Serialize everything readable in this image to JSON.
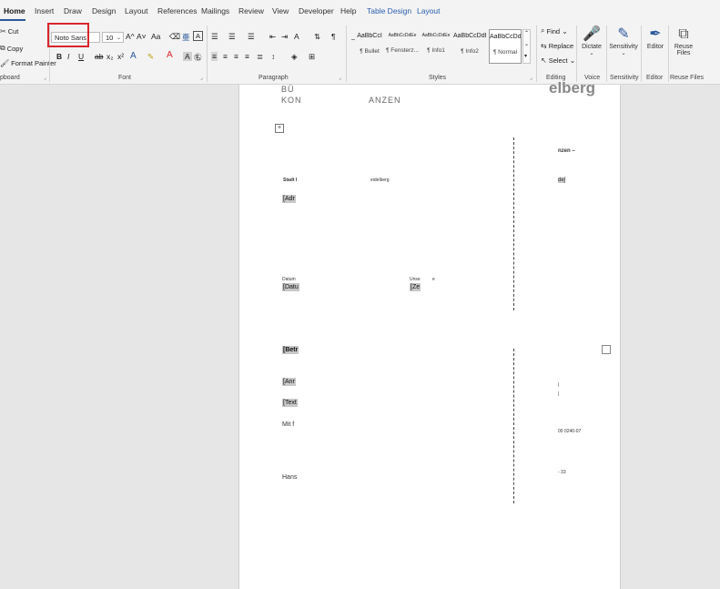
{
  "tabs": [
    "Home",
    "Insert",
    "Draw",
    "Design",
    "Layout",
    "References",
    "Mailings",
    "Review",
    "View",
    "Developer",
    "Help",
    "Table Design",
    "Layout"
  ],
  "clipboard": {
    "cut": "Cut",
    "copy": "Copy",
    "format_painter": "Format Painter",
    "label": "pboard"
  },
  "font": {
    "family": "Noto Sans",
    "size": "10",
    "label": "Font",
    "grow": "A^",
    "shrink": "A˅",
    "change_case": "Aa",
    "clear": "A",
    "bold": "B",
    "italic": "I",
    "underline": "U",
    "strike": "ab",
    "subscript": "x₂",
    "superscript": "x²",
    "effects": "A",
    "highlight": "✎",
    "font_color": "A"
  },
  "paragraph": {
    "label": "Paragraph"
  },
  "styles": {
    "label": "Styles",
    "items": [
      {
        "sample": "AaBbCcI",
        "name": "¶ Bullet"
      },
      {
        "sample": "AaBbCcDdEe",
        "name": "¶ Fensterz..."
      },
      {
        "sample": "AaBbCcDdEe",
        "name": "¶ Info1"
      },
      {
        "sample": "AaBbCcDdI",
        "name": "¶ Info2"
      },
      {
        "sample": "AaBbCcDdI",
        "name": "¶ Normal"
      }
    ]
  },
  "editing": {
    "label": "Editing",
    "find": "Find",
    "replace": "Replace",
    "select": "Select"
  },
  "voice": {
    "label": "Voice",
    "dictate": "Dictate"
  },
  "sensitivity": {
    "label": "Sensitivity",
    "button": "Sensitivity"
  },
  "editor": {
    "label": "Editor",
    "button": "Editor"
  },
  "reuse": {
    "label": "Reuse Files",
    "button_line1": "Reuse",
    "button_line2": "Files"
  },
  "document": {
    "header_left_1": "BÜ",
    "header_left_2": "KON",
    "header_mid": "ANZEN",
    "header_right": "elberg",
    "right_note": "nzen –",
    "sender_label": "Stadt I",
    "sender_city": "eidelberg",
    "address_field": "[Adr",
    "right_field": "de]",
    "date_label": "Datum",
    "date_field": "[Datu",
    "unser_label": "Unse",
    "unser_suffix": "e",
    "zeichen_field": "[Ze",
    "betreff_field": "[Betr",
    "anrede_field": "[Anr",
    "text_field": "[Text",
    "closing": "Mit f",
    "signature": "Hans",
    "phone": "00 0240-07",
    "phone_tail": "- 33",
    "sep1": "|",
    "sep2": "|"
  },
  "colors": {
    "accent": "#2b579a",
    "highlight_border": "#d9262c",
    "field_shading": "#c8c8c8"
  }
}
